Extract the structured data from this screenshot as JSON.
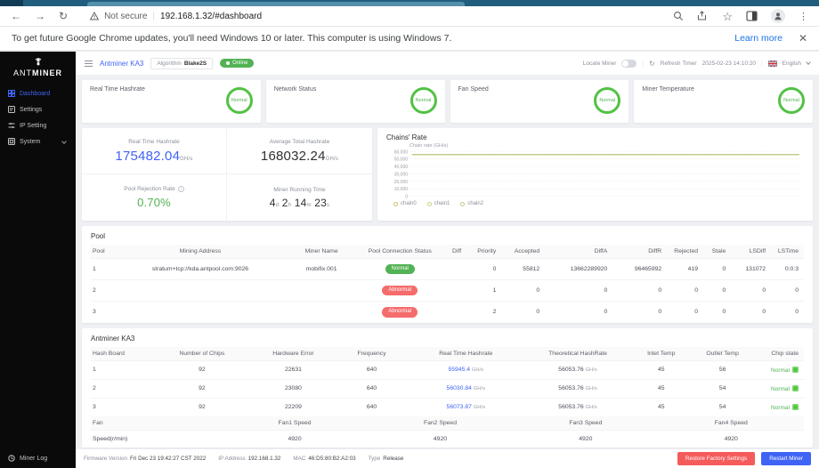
{
  "browser": {
    "security_label": "Not secure",
    "url": "192.168.1.32/#dashboard",
    "notification": {
      "message": "To get future Google Chrome updates, you'll need Windows 10 or later. This computer is using Windows 7.",
      "learn_more": "Learn more"
    }
  },
  "sidebar": {
    "brand_ant": "ANT",
    "brand_miner": "MINER",
    "items": [
      {
        "label": "Dashboard"
      },
      {
        "label": "Settings"
      },
      {
        "label": "IP Setting"
      },
      {
        "label": "System"
      }
    ],
    "miner_log": "Miner Log"
  },
  "topbar": {
    "device": "Antminer KA3",
    "algorithm_label": "Algorithm",
    "algorithm_value": "Blake2S",
    "online_status": "Online",
    "locate_miner_label": "Locate Miner",
    "refresh_label": "Refresh Timer",
    "refresh_time": "2025-02-23 14:10:20",
    "language": "English"
  },
  "status_cards": [
    {
      "title": "Real Time Hashrate",
      "status": "Normal"
    },
    {
      "title": "Network Status",
      "status": "Normal"
    },
    {
      "title": "Fan Speed",
      "status": "Normal"
    },
    {
      "title": "Miner Temperature",
      "status": "Normal"
    }
  ],
  "stats": {
    "rt_label": "Real Time Hashrate",
    "rt_value": "175482.04",
    "rt_unit": "GH/s",
    "avg_label": "Average Total Hashrate",
    "avg_value": "168032.24",
    "avg_unit": "GH/s",
    "reject_label": "Pool Rejection Rate",
    "reject_value": "0.70%",
    "runtime_label": "Miner Running Time",
    "runtime_d": "4",
    "runtime_d_unit": "d",
    "runtime_h": "2",
    "runtime_h_unit": "h",
    "runtime_m": "14",
    "runtime_m_unit": "m",
    "runtime_s": "23",
    "runtime_s_unit": "s"
  },
  "chart_data": {
    "type": "line",
    "title": "Chains' Rate",
    "ylabel": "Chain rate (GH/s)",
    "ylim": [
      0,
      60000
    ],
    "yticks": [
      "60,000",
      "50,000",
      "40,000",
      "30,000",
      "20,000",
      "10,000",
      "0"
    ],
    "grid": true,
    "legend_position": "bottom",
    "series": [
      {
        "name": "chain0",
        "color": "#d2c26e",
        "values": [
          55945.4,
          55945.4
        ]
      },
      {
        "name": "chain1",
        "color": "#cbcf7a",
        "values": [
          56030.84,
          56030.84
        ]
      },
      {
        "name": "chain2",
        "color": "#bccf8d",
        "values": [
          56073.87,
          56073.87
        ]
      }
    ]
  },
  "pool": {
    "title": "Pool",
    "headers": [
      "Pool",
      "Mining Address",
      "Miner Name",
      "Pool Connection Status",
      "Diff",
      "Priority",
      "Accepted",
      "DiffA",
      "DiffR",
      "Rejected",
      "Stale",
      "LSDiff",
      "LSTime"
    ],
    "rows": [
      {
        "pool": "1",
        "address": "stratum+tcp://kda.antpool.com:9026",
        "miner": "mobifix.001",
        "status": "Normal",
        "diff": "",
        "priority": "0",
        "accepted": "55812",
        "diffa": "13662289920",
        "diffr": "96465992",
        "rejected": "419",
        "stale": "0",
        "lsdiff": "131072",
        "lstime": "0:0:3"
      },
      {
        "pool": "2",
        "address": "",
        "miner": "",
        "status": "Abnormal",
        "diff": "",
        "priority": "1",
        "accepted": "0",
        "diffa": "0",
        "diffr": "0",
        "rejected": "0",
        "stale": "0",
        "lsdiff": "0",
        "lstime": "0"
      },
      {
        "pool": "3",
        "address": "",
        "miner": "",
        "status": "Abnormal",
        "diff": "",
        "priority": "2",
        "accepted": "0",
        "diffa": "0",
        "diffr": "0",
        "rejected": "0",
        "stale": "0",
        "lsdiff": "0",
        "lstime": "0"
      }
    ]
  },
  "boards": {
    "title": "Antminer KA3",
    "headers": [
      "Hash Board",
      "Number of Chips",
      "Hardware Error",
      "Frequency",
      "Real Time Hashrate",
      "Theoretical HashRate",
      "Inlet Temp",
      "Outlet Temp",
      "Chip state"
    ],
    "rows": [
      {
        "board": "1",
        "chips": "92",
        "hw": "22631",
        "freq": "640",
        "rt": "55945.4",
        "rt_unit": "GH/s",
        "theory": "56053.76",
        "theory_unit": "GH/s",
        "inlet": "45",
        "outlet": "56",
        "state": "Normal"
      },
      {
        "board": "2",
        "chips": "92",
        "hw": "23080",
        "freq": "640",
        "rt": "56030.84",
        "rt_unit": "GH/s",
        "theory": "56053.76",
        "theory_unit": "GH/s",
        "inlet": "45",
        "outlet": "54",
        "state": "Normal"
      },
      {
        "board": "3",
        "chips": "92",
        "hw": "22209",
        "freq": "640",
        "rt": "56073.87",
        "rt_unit": "GH/s",
        "theory": "56053.76",
        "theory_unit": "GH/s",
        "inlet": "45",
        "outlet": "54",
        "state": "Normal"
      }
    ],
    "fan_headers": [
      "Fan",
      "Fan1 Speed",
      "Fan2 Speed",
      "Fan3 Speed",
      "Fan4 Speed"
    ],
    "fan_label": "Speed(r/min)",
    "fan_values": [
      "4920",
      "4920",
      "4920",
      "4920"
    ]
  },
  "footer": {
    "firmware_label": "Firmware Version",
    "firmware_value": "Fri Dec 23 19:42:27 CST 2022",
    "ip_label": "IP Address",
    "ip_value": "192.168.1.32",
    "mac_label": "MAC",
    "mac_value": "46:D5:80:B2:A2:03",
    "type_label": "Type",
    "type_value": "Release",
    "restore_button": "Restore Factory Settings",
    "restart_button": "Restart Miner"
  },
  "colors": {
    "accent_blue": "#3f63f5",
    "ok_green": "#52b254",
    "alert_red": "#f56c6c",
    "chart_line": "#d2c26e"
  }
}
